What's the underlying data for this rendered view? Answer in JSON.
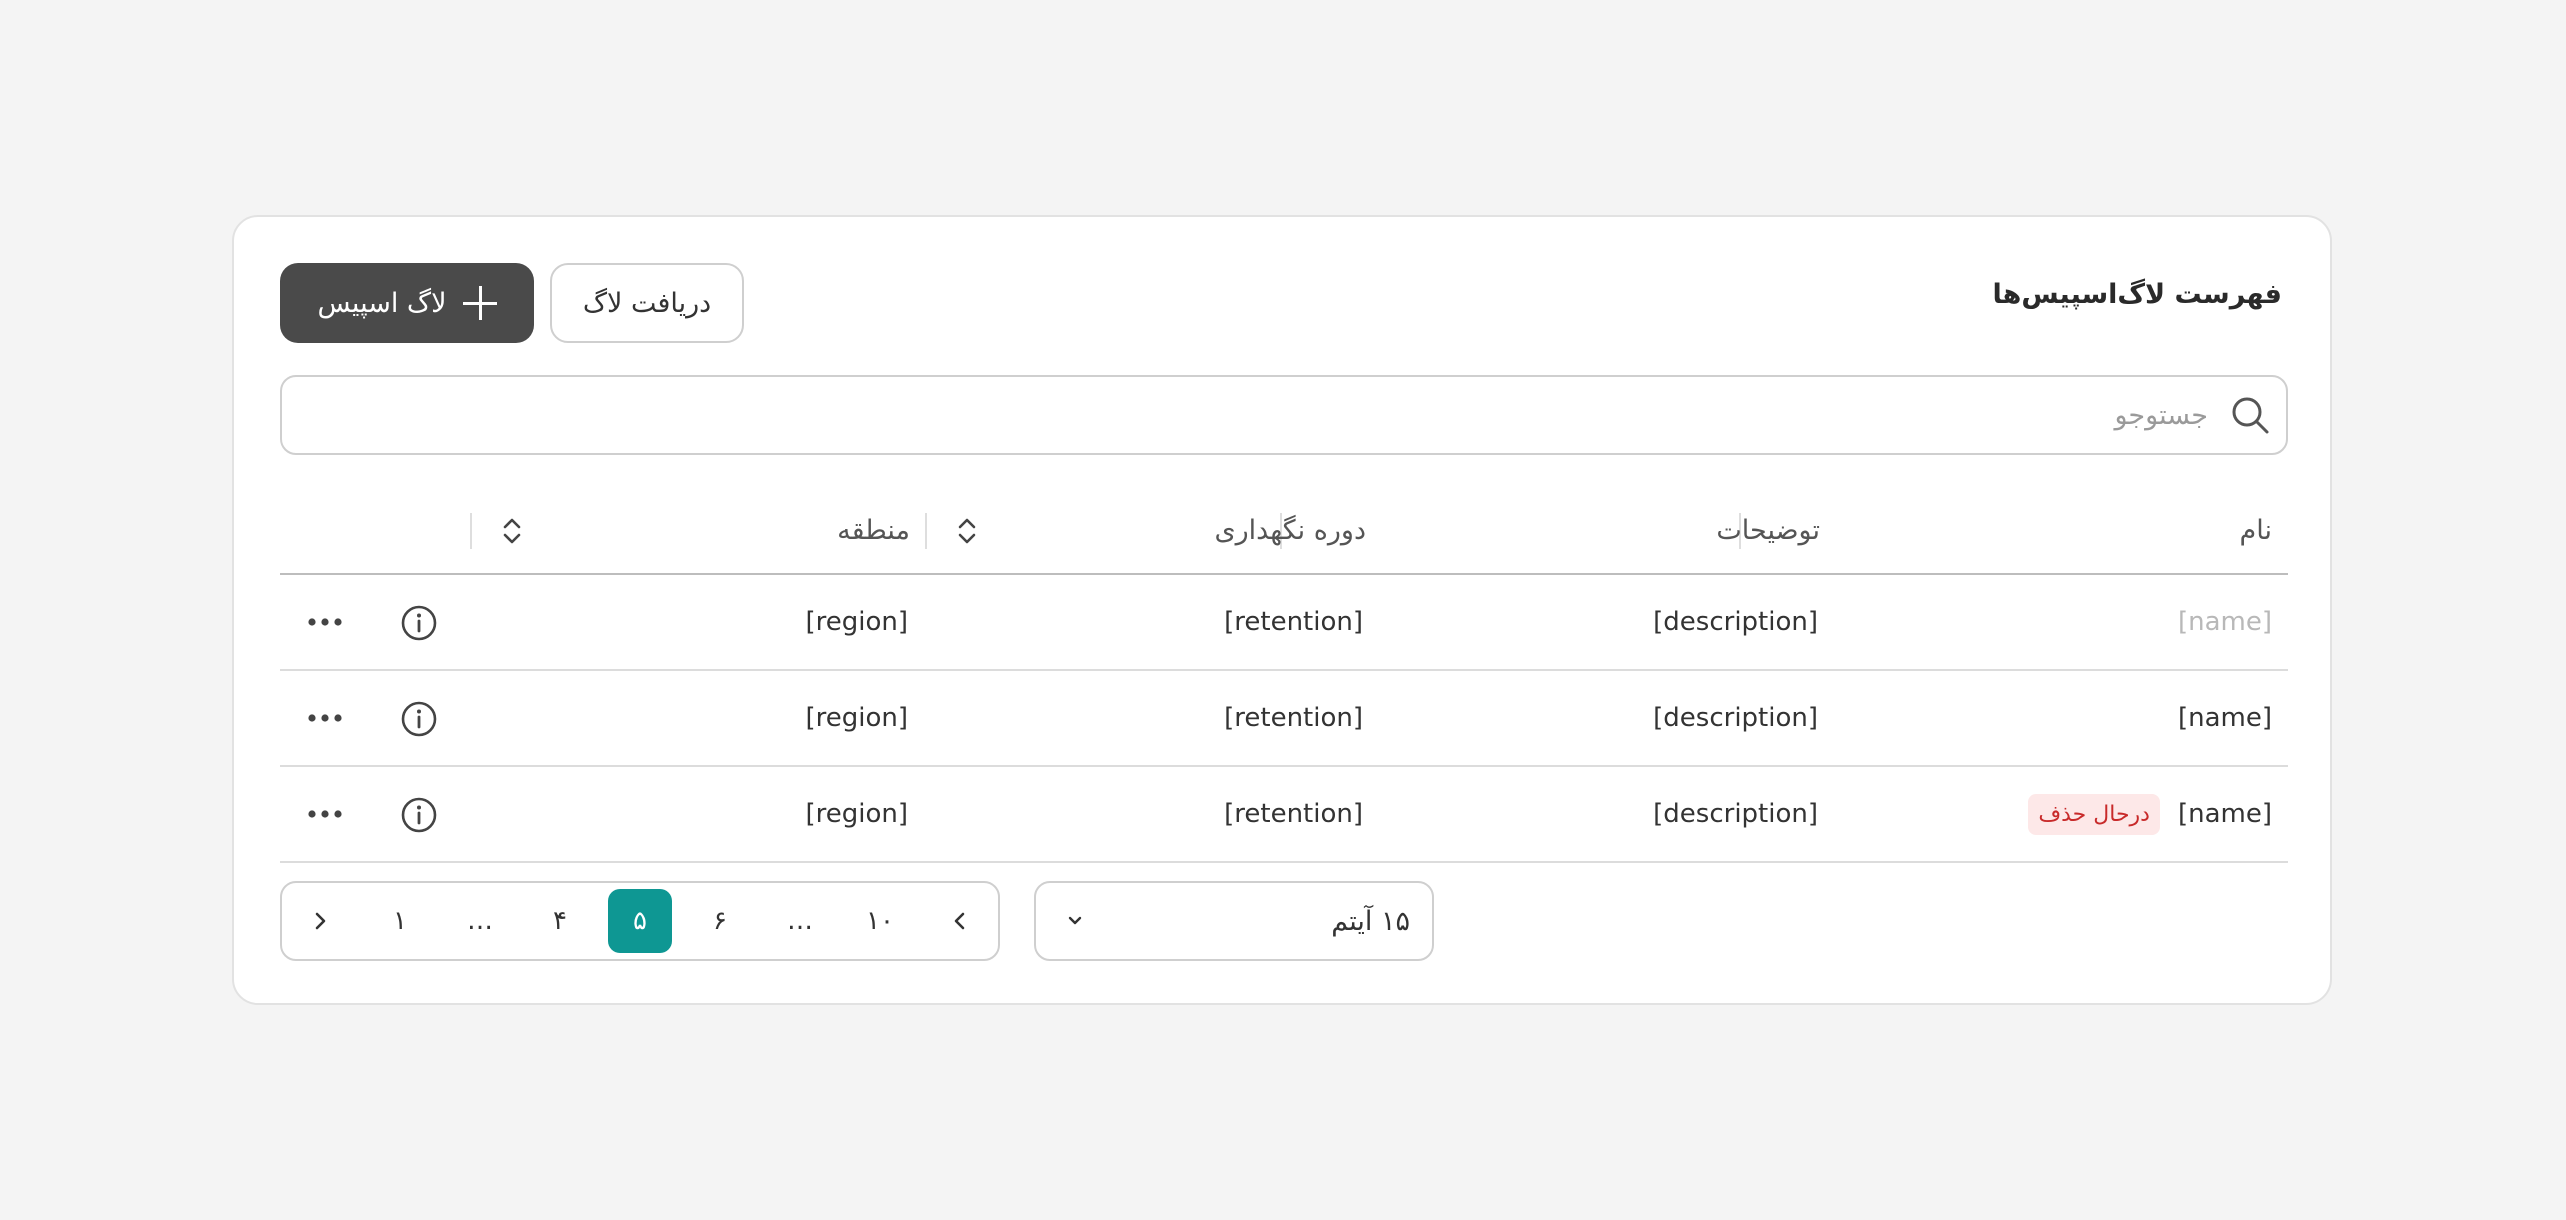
{
  "header": {
    "title": "فهرست لاگ‌اسپیس‌ها",
    "primary_button_label": "لاگ اسپیس",
    "primary_button_icon": "plus-icon",
    "secondary_button_label": "دریافت لاگ"
  },
  "search": {
    "placeholder": "جستوجو",
    "value": "",
    "icon": "search-icon"
  },
  "table": {
    "columns": [
      "نام",
      "توضیحات",
      "دوره نگهداری",
      "منطقه"
    ],
    "rows": [
      {
        "name": "[name]",
        "name_muted": true,
        "badge": "",
        "description": "[description]",
        "retention": "[retention]",
        "region": "[region]"
      },
      {
        "name": "[name]",
        "name_muted": false,
        "badge": "",
        "description": "[description]",
        "retention": "[retention]",
        "region": "[region]"
      },
      {
        "name": "[name]",
        "name_muted": false,
        "badge": "درحال حذف",
        "description": "[description]",
        "retention": "[retention]",
        "region": "[region]"
      }
    ]
  },
  "pagination": {
    "pages": [
      "۱۰",
      "…",
      "۶",
      "۵",
      "۴",
      "…",
      "۱"
    ],
    "current": "۵",
    "per_page_label": "۱۵ آیتم"
  },
  "colors": {
    "accent": "#0e9793",
    "primary_button": "#4a4a4a",
    "badge_bg": "#fde8e8",
    "badge_text": "#c82a2a"
  }
}
